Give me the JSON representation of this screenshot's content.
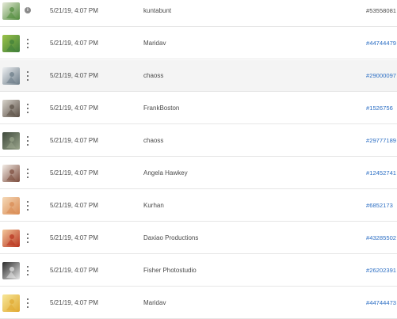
{
  "rows": [
    {
      "date": "5/21/19, 4:07 PM",
      "author": "kuntabunt",
      "asset_id": "#53558081",
      "menu_icon": "info-icon",
      "highlight": false,
      "id_linked": false,
      "thumb_colors": [
        "#e6ead8",
        "#4f8a3a"
      ]
    },
    {
      "date": "5/21/19, 4:07 PM",
      "author": "Maridav",
      "asset_id": "#44744479",
      "menu_icon": "more-vertical-icon",
      "highlight": false,
      "id_linked": true,
      "thumb_colors": [
        "#9cc34a",
        "#3e7d3a"
      ]
    },
    {
      "date": "5/21/19, 4:07 PM",
      "author": "chaoss",
      "asset_id": "#29000097",
      "menu_icon": "more-vertical-icon",
      "highlight": true,
      "id_linked": true,
      "thumb_colors": [
        "#eef0f2",
        "#6a7a86"
      ]
    },
    {
      "date": "5/21/19, 4:07 PM",
      "author": "FrankBoston",
      "asset_id": "#1526756",
      "menu_icon": "more-vertical-icon",
      "highlight": false,
      "id_linked": true,
      "thumb_colors": [
        "#d8d4cc",
        "#5a4e44"
      ]
    },
    {
      "date": "5/21/19, 4:07 PM",
      "author": "chaoss",
      "asset_id": "#29777189",
      "menu_icon": "more-vertical-icon",
      "highlight": false,
      "id_linked": true,
      "thumb_colors": [
        "#3f4a3c",
        "#9aa58c"
      ]
    },
    {
      "date": "5/21/19, 4:07 PM",
      "author": "Angela Hawkey",
      "asset_id": "#12452741",
      "menu_icon": "more-vertical-icon",
      "highlight": false,
      "id_linked": true,
      "thumb_colors": [
        "#f3ece6",
        "#7a4a3a"
      ]
    },
    {
      "date": "5/21/19, 4:07 PM",
      "author": "Kurhan",
      "asset_id": "#6852173",
      "menu_icon": "more-vertical-icon",
      "highlight": false,
      "id_linked": true,
      "thumb_colors": [
        "#f5d9b8",
        "#d98a52"
      ]
    },
    {
      "date": "5/21/19, 4:07 PM",
      "author": "Daxiao Productions",
      "asset_id": "#43285502",
      "menu_icon": "more-vertical-icon",
      "highlight": false,
      "id_linked": true,
      "thumb_colors": [
        "#f2c79a",
        "#b8321e"
      ]
    },
    {
      "date": "5/21/19, 4:07 PM",
      "author": "Fisher Photostudio",
      "asset_id": "#26202391",
      "menu_icon": "more-vertical-icon",
      "highlight": false,
      "id_linked": true,
      "thumb_colors": [
        "#2a2a2a",
        "#e8e8e8"
      ]
    },
    {
      "date": "5/21/19, 4:07 PM",
      "author": "Maridav",
      "asset_id": "#44744473",
      "menu_icon": "more-vertical-icon",
      "highlight": false,
      "id_linked": true,
      "thumb_colors": [
        "#f7e79a",
        "#e0a830"
      ]
    }
  ]
}
